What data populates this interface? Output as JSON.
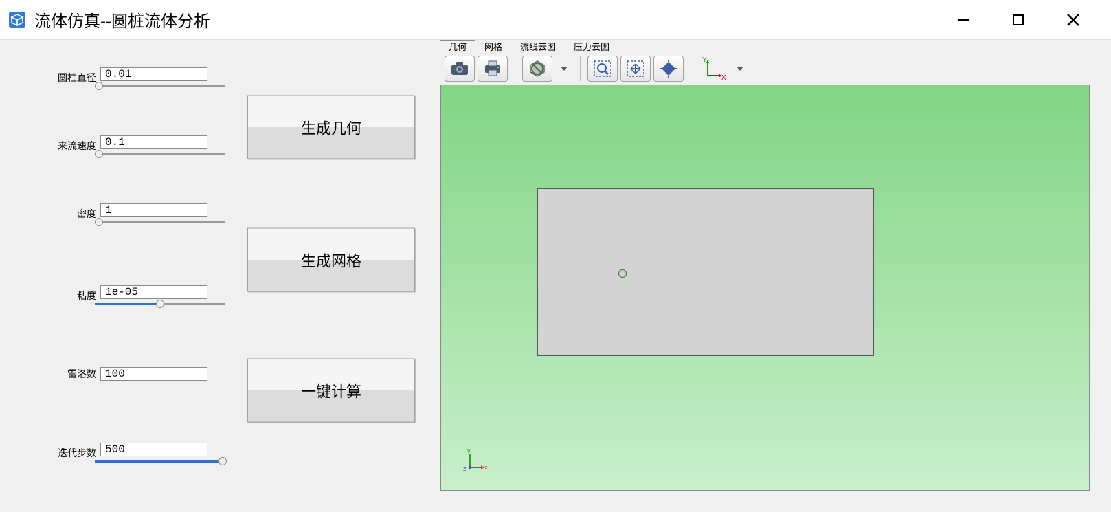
{
  "window": {
    "title": "流体仿真--圆桩流体分析"
  },
  "params": {
    "diameter": {
      "label": "圆柱直径",
      "value": "0.01"
    },
    "velocity": {
      "label": "来流速度",
      "value": "0.1"
    },
    "density": {
      "label": "密度",
      "value": "1"
    },
    "viscosity": {
      "label": "粘度",
      "value": "1e-05"
    },
    "reynolds": {
      "label": "雷洛数",
      "value": "100"
    },
    "steps": {
      "label": "迭代步数",
      "value": "500"
    }
  },
  "buttons": {
    "gen_geometry": "生成几何",
    "gen_mesh": "生成网格",
    "one_click_calc": "一键计算"
  },
  "tabs": {
    "geometry": "几何",
    "mesh": "网格",
    "streamline": "流线云图",
    "pressure": "压力云图",
    "active": "geometry"
  },
  "toolbar_icons": {
    "camera": "camera-icon",
    "print": "print-icon",
    "block": "block-icon",
    "zoom_area": "zoom-area-icon",
    "fit": "fit-view-icon",
    "expand": "expand-icon",
    "axis": "axis-icon"
  },
  "axis_labels": {
    "x": "x",
    "y": "y",
    "z": "z",
    "X": "X",
    "Y": "Y"
  }
}
